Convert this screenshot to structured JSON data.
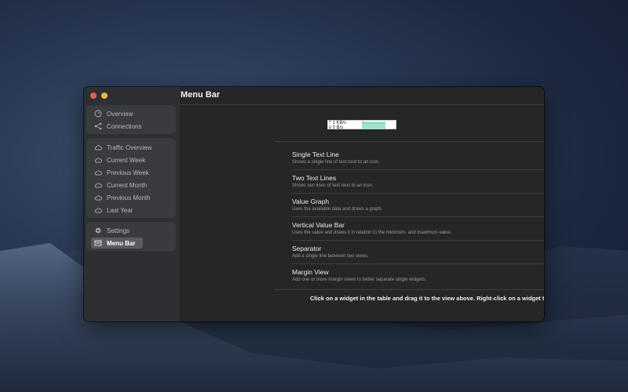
{
  "window": {
    "title": "Menu Bar"
  },
  "sidebar": {
    "group1": [
      {
        "label": "Overview",
        "icon": "gauge-icon"
      },
      {
        "label": "Connections",
        "icon": "share-icon"
      }
    ],
    "group2": [
      {
        "label": "Traffic Overview",
        "icon": "cloud-icon"
      },
      {
        "label": "Current Week",
        "icon": "cloud-icon"
      },
      {
        "label": "Previous Week",
        "icon": "cloud-icon"
      },
      {
        "label": "Current Month",
        "icon": "cloud-icon"
      },
      {
        "label": "Previous Month",
        "icon": "cloud-icon"
      },
      {
        "label": "Last Year",
        "icon": "cloud-icon"
      }
    ],
    "group3": [
      {
        "label": "Settings",
        "icon": "gear-icon"
      },
      {
        "label": "Menu Bar",
        "icon": "menu-bar-icon",
        "selected": true
      }
    ]
  },
  "preview": {
    "upload": "1 KB/s",
    "download": "0 B/s"
  },
  "widgets": [
    {
      "title": "Single Text Line",
      "description": "Shows a single line of text next to an icon."
    },
    {
      "title": "Two Text Lines",
      "description": "Shows two lines of text next to an icon."
    },
    {
      "title": "Value Graph",
      "description": "Uses the available data and draws a graph."
    },
    {
      "title": "Vertical Value Bar",
      "description": "Uses the value and draws it in relation to the minimum- and maximum-value."
    },
    {
      "title": "Separator",
      "description": "Add a single line between two views."
    },
    {
      "title": "Margin View",
      "description": "Add one or more margin views to better separate single widgets."
    }
  ],
  "hint": "Click on a widget in the table and drag it to the view above. Right-click on a widget to configure it.",
  "colors": {
    "close": "#ee5b55",
    "minimize": "#f3b83a",
    "graph_fill": "#9fe1cc"
  }
}
